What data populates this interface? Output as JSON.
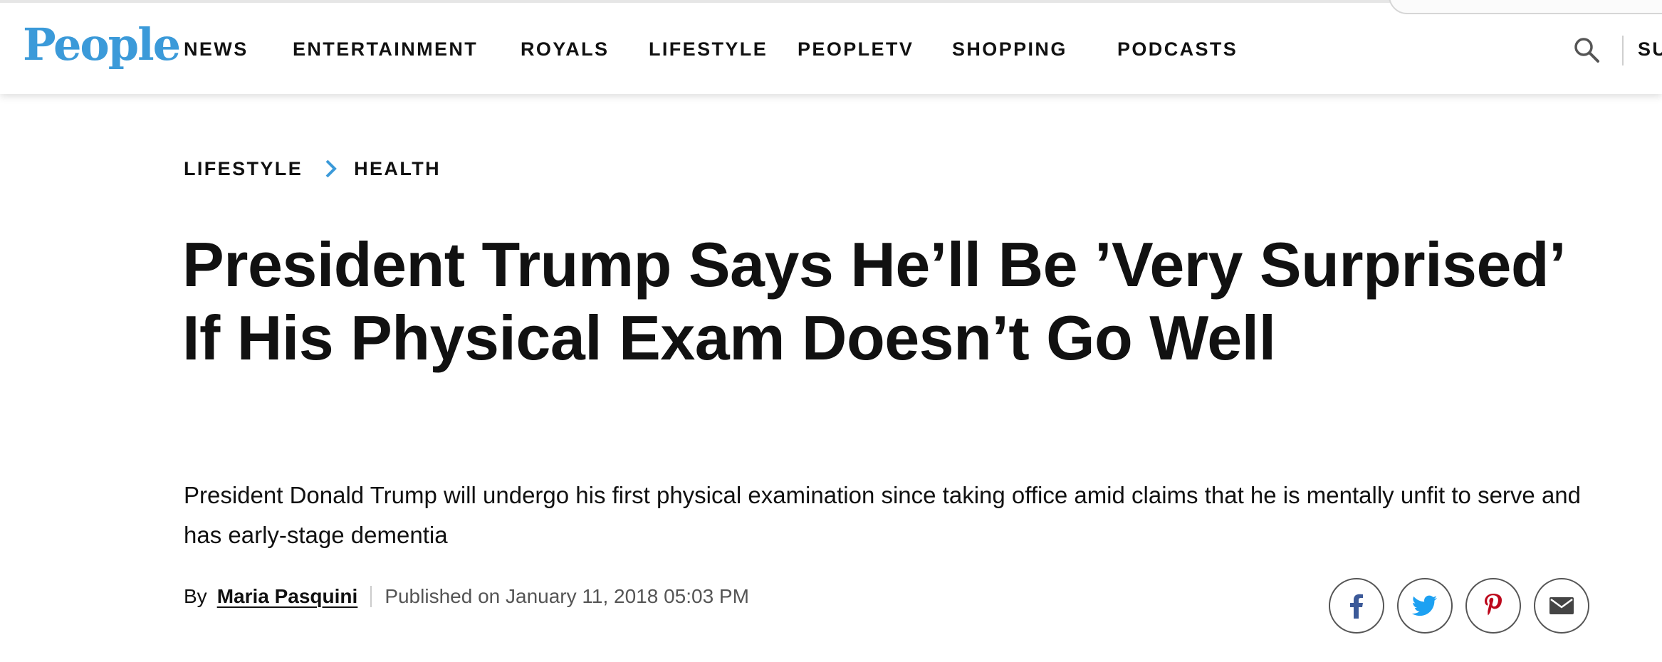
{
  "header": {
    "logo": "People",
    "nav": [
      "NEWS",
      "ENTERTAINMENT",
      "ROYALS",
      "LIFESTYLE",
      "PEOPLETV",
      "SHOPPING",
      "PODCASTS"
    ],
    "subscribe_label": "SU",
    "icons": {
      "search": "search-icon"
    }
  },
  "article": {
    "breadcrumb": [
      "LIFESTYLE",
      "HEALTH"
    ],
    "headline": "President Trump Says He’ll Be ’Very Surprised’ If His Physical Exam Doesn’t Go Well",
    "dek": "President Donald Trump will undergo his first physical examination since taking office amid claims that he is mentally unfit to serve and has early-stage dementia",
    "byline": {
      "by": "By",
      "author": "Maria Pasquini",
      "published": "Published on January 11, 2018 05:03 PM"
    },
    "share": [
      {
        "name": "facebook-share-button",
        "icon": "facebook-icon",
        "glyph": "f",
        "color": "#3b5998"
      },
      {
        "name": "twitter-share-button",
        "icon": "twitter-icon",
        "glyph": "",
        "color": "#1da1f2"
      },
      {
        "name": "pinterest-share-button",
        "icon": "pinterest-icon",
        "glyph": "P",
        "color": "#bd081c"
      },
      {
        "name": "email-share-button",
        "icon": "mail-icon",
        "glyph": "",
        "color": "#444444"
      }
    ]
  },
  "colors": {
    "brand": "#3b9ad9",
    "text": "#111111",
    "muted": "#555555"
  }
}
